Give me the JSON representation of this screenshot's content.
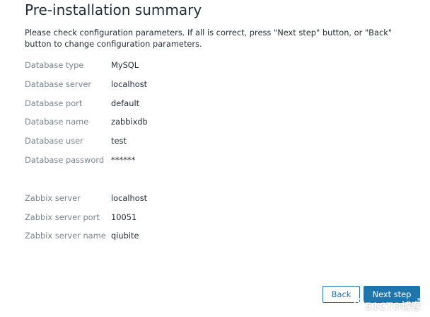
{
  "page": {
    "title": "Pre-installation summary",
    "description": "Please check configuration parameters. If all is correct, press \"Next step\" button, or \"Back\" button to change configuration parameters."
  },
  "database": [
    {
      "label": "Database type",
      "value": "MySQL"
    },
    {
      "label": "Database server",
      "value": "localhost"
    },
    {
      "label": "Database port",
      "value": "default"
    },
    {
      "label": "Database name",
      "value": "zabbixdb"
    },
    {
      "label": "Database user",
      "value": "test"
    },
    {
      "label": "Database password",
      "value": "******"
    }
  ],
  "server": [
    {
      "label": "Zabbix server",
      "value": "localhost"
    },
    {
      "label": "Zabbix server port",
      "value": "10051"
    },
    {
      "label": "Zabbix server name",
      "value": "qiubite"
    }
  ],
  "buttons": {
    "back": "Back",
    "next": "Next step"
  },
  "watermark": {
    "text": "51CTO博客",
    "sub": "Blog"
  },
  "colors": {
    "accent": "#1f76ad",
    "label": "#77858c",
    "text": "#1f2c33"
  }
}
